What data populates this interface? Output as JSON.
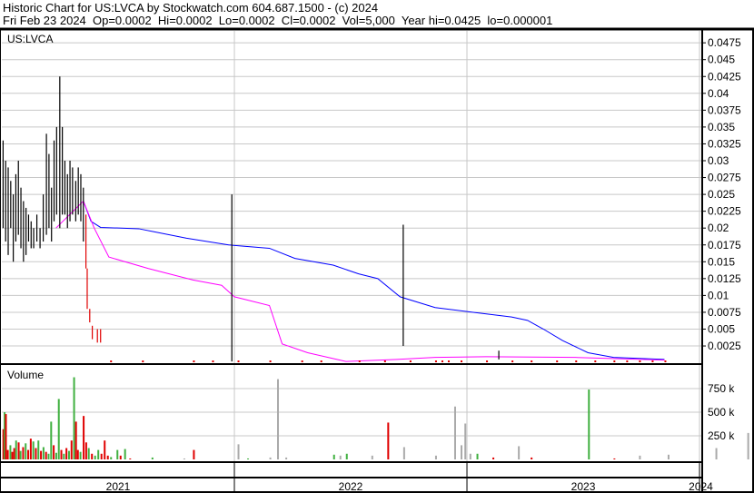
{
  "header": {
    "title": "Historic Chart for US:LVCA by Stockwatch.com 604.687.1500 - (c) 2024",
    "quote": "Fri Feb 23 2024  Op=0.0002  Hi=0.0002  Lo=0.0002  Cl=0.0002  Vol=5,000  Year hi=0.0425  lo=0.000001"
  },
  "chart_data": {
    "type": "line",
    "title": "US:LVCA",
    "volume_label": "Volume",
    "x_unit": "days since 2021-01-01",
    "x_range": [
      0,
      1100
    ],
    "year_ticks": [
      {
        "label": "2021",
        "day": 0
      },
      {
        "label": "2022",
        "day": 365
      },
      {
        "label": "2023",
        "day": 730
      },
      {
        "label": "2024",
        "day": 1095
      }
    ],
    "price_ylim": [
      0,
      0.05
    ],
    "price_ticks": [
      "0.0025",
      "0.005",
      "0.0075",
      "0.01",
      "0.0125",
      "0.015",
      "0.0175",
      "0.02",
      "0.0225",
      "0.025",
      "0.0275",
      "0.03",
      "0.0325",
      "0.035",
      "0.0375",
      "0.04",
      "0.0425",
      "0.045",
      "0.0475"
    ],
    "volume_ylim": [
      0,
      1000000
    ],
    "volume_ticks": [
      {
        "label": "250 k",
        "value": 250000
      },
      {
        "label": "500 k",
        "value": 500000
      },
      {
        "label": "750 k",
        "value": 750000
      }
    ],
    "price_bars": [
      [
        2,
        0.033,
        0.02
      ],
      [
        6,
        0.03,
        0.018
      ],
      [
        10,
        0.029,
        0.016
      ],
      [
        14,
        0.027,
        0.02
      ],
      [
        18,
        0.025,
        0.015
      ],
      [
        22,
        0.028,
        0.018
      ],
      [
        26,
        0.03,
        0.019
      ],
      [
        30,
        0.026,
        0.017
      ],
      [
        34,
        0.024,
        0.015
      ],
      [
        38,
        0.023,
        0.016
      ],
      [
        42,
        0.022,
        0.018
      ],
      [
        46,
        0.021,
        0.017
      ],
      [
        50,
        0.02,
        0.017
      ],
      [
        55,
        0.022,
        0.018
      ],
      [
        60,
        0.02,
        0.017
      ],
      [
        65,
        0.025,
        0.018
      ],
      [
        70,
        0.034,
        0.019
      ],
      [
        74,
        0.031,
        0.02
      ],
      [
        78,
        0.026,
        0.018
      ],
      [
        82,
        0.033,
        0.021
      ],
      [
        86,
        0.035,
        0.022
      ],
      [
        91,
        0.0425,
        0.02
      ],
      [
        95,
        0.035,
        0.022
      ],
      [
        99,
        0.03,
        0.022
      ],
      [
        103,
        0.028,
        0.02
      ],
      [
        107,
        0.03,
        0.021
      ],
      [
        111,
        0.029,
        0.022
      ],
      [
        116,
        0.027,
        0.021
      ],
      [
        120,
        0.029,
        0.022
      ],
      [
        124,
        0.028,
        0.021
      ],
      [
        128,
        0.026,
        0.018
      ],
      [
        132,
        0.022,
        0.014
      ],
      [
        134,
        0.014,
        0.008
      ],
      [
        138,
        0.008,
        0.006
      ],
      [
        142,
        0.0055,
        0.0035
      ],
      [
        150,
        0.005,
        0.003
      ],
      [
        155,
        0.005,
        0.003
      ],
      [
        361,
        0.025,
        0.0002
      ],
      [
        630,
        0.0205,
        0.0025
      ],
      [
        780,
        0.0018,
        0.0005
      ]
    ],
    "low_dots": [
      170,
      220,
      300,
      330,
      370,
      420,
      470,
      500,
      560,
      600,
      640,
      680,
      690,
      700,
      720,
      760,
      800,
      830,
      870,
      900,
      930,
      960,
      980,
      1000,
      1020,
      1040
    ],
    "ma_long": [
      [
        128,
        0.024
      ],
      [
        140,
        0.021
      ],
      [
        155,
        0.0201
      ],
      [
        215,
        0.0199
      ],
      [
        290,
        0.0185
      ],
      [
        356,
        0.0175
      ],
      [
        420,
        0.017
      ],
      [
        460,
        0.0155
      ],
      [
        520,
        0.0145
      ],
      [
        560,
        0.0132
      ],
      [
        590,
        0.0125
      ],
      [
        625,
        0.0098
      ],
      [
        680,
        0.0082
      ],
      [
        740,
        0.0075
      ],
      [
        800,
        0.0068
      ],
      [
        825,
        0.0063
      ],
      [
        850,
        0.005
      ],
      [
        880,
        0.0033
      ],
      [
        920,
        0.0015
      ],
      [
        960,
        0.0008
      ],
      [
        1040,
        0.0005
      ]
    ],
    "ma_short": [
      [
        85,
        0.02
      ],
      [
        128,
        0.024
      ],
      [
        145,
        0.02
      ],
      [
        168,
        0.0157
      ],
      [
        230,
        0.014
      ],
      [
        300,
        0.0123
      ],
      [
        345,
        0.0115
      ],
      [
        365,
        0.0098
      ],
      [
        420,
        0.0085
      ],
      [
        440,
        0.0028
      ],
      [
        480,
        0.0015
      ],
      [
        540,
        0.0002
      ],
      [
        620,
        0.0005
      ],
      [
        680,
        0.0008
      ],
      [
        760,
        0.0009
      ],
      [
        900,
        0.0008
      ],
      [
        1040,
        0.0004
      ]
    ],
    "volume_bars": [
      [
        1,
        320000,
        "#e00000"
      ],
      [
        3,
        500000,
        "#40b040"
      ],
      [
        5,
        480000,
        "#e00000"
      ],
      [
        8,
        100000,
        "#e00000"
      ],
      [
        12,
        150000,
        "#40b040"
      ],
      [
        15,
        80000,
        "#e00000"
      ],
      [
        18,
        120000,
        "#e00000"
      ],
      [
        21,
        200000,
        "#40b040"
      ],
      [
        25,
        180000,
        "#e00000"
      ],
      [
        28,
        90000,
        "#40b040"
      ],
      [
        32,
        130000,
        "#e00000"
      ],
      [
        36,
        170000,
        "#40b040"
      ],
      [
        40,
        100000,
        "#e00000"
      ],
      [
        44,
        220000,
        "#e00000"
      ],
      [
        48,
        190000,
        "#40b040"
      ],
      [
        52,
        120000,
        "#e00000"
      ],
      [
        56,
        200000,
        "#40b040"
      ],
      [
        60,
        90000,
        "#e00000"
      ],
      [
        64,
        130000,
        "#40b040"
      ],
      [
        68,
        80000,
        "#e00000"
      ],
      [
        72,
        60000,
        "#40b040"
      ],
      [
        76,
        400000,
        "#40b040"
      ],
      [
        80,
        150000,
        "#e00000"
      ],
      [
        84,
        70000,
        "#40b040"
      ],
      [
        88,
        640000,
        "#40b040"
      ],
      [
        92,
        100000,
        "#e00000"
      ],
      [
        96,
        60000,
        "#40b040"
      ],
      [
        100,
        120000,
        "#e00000"
      ],
      [
        104,
        90000,
        "#40b040"
      ],
      [
        108,
        200000,
        "#e00000"
      ],
      [
        112,
        870000,
        "#40b040"
      ],
      [
        115,
        400000,
        "#e00000"
      ],
      [
        118,
        100000,
        "#e00000"
      ],
      [
        122,
        80000,
        "#40b040"
      ],
      [
        127,
        460000,
        "#e00000"
      ],
      [
        131,
        180000,
        "#e00000"
      ],
      [
        135,
        120000,
        "#40b040"
      ],
      [
        140,
        60000,
        "#e00000"
      ],
      [
        145,
        40000,
        "#40b040"
      ],
      [
        150,
        100000,
        "#40b040"
      ],
      [
        155,
        60000,
        "#e00000"
      ],
      [
        160,
        200000,
        "#e00000"
      ],
      [
        165,
        40000,
        "#e00000"
      ],
      [
        170,
        25000,
        "#40b040"
      ],
      [
        180,
        100000,
        "#40b040"
      ],
      [
        185,
        40000,
        "#e00000"
      ],
      [
        192,
        110000,
        "#40b040"
      ],
      [
        200,
        10000,
        "#e00000"
      ],
      [
        235,
        20000,
        "#40b040"
      ],
      [
        285,
        10000,
        "#aaaaaa"
      ],
      [
        300,
        100000,
        "#e00000"
      ],
      [
        370,
        160000,
        "#aaaaaa"
      ],
      [
        385,
        10000,
        "#40b040"
      ],
      [
        420,
        20000,
        "#aaaaaa"
      ],
      [
        432,
        850000,
        "#aaaaaa"
      ],
      [
        445,
        20000,
        "#aaaaaa"
      ],
      [
        520,
        50000,
        "#40b040"
      ],
      [
        530,
        40000,
        "#aaaaaa"
      ],
      [
        540,
        60000,
        "#40b040"
      ],
      [
        580,
        40000,
        "#aaaaaa"
      ],
      [
        605,
        390000,
        "#e00000"
      ],
      [
        630,
        130000,
        "#aaaaaa"
      ],
      [
        680,
        40000,
        "#aaaaaa"
      ],
      [
        710,
        560000,
        "#aaaaaa"
      ],
      [
        720,
        150000,
        "#aaaaaa"
      ],
      [
        726,
        380000,
        "#aaaaaa"
      ],
      [
        734,
        60000,
        "#aaaaaa"
      ],
      [
        745,
        60000,
        "#40b040"
      ],
      [
        770,
        20000,
        "#e00000"
      ],
      [
        810,
        140000,
        "#aaaaaa"
      ],
      [
        830,
        20000,
        "#e00000"
      ],
      [
        920,
        740000,
        "#40b040"
      ],
      [
        960,
        10000,
        "#e00000"
      ],
      [
        1000,
        40000,
        "#aaaaaa"
      ],
      [
        1045,
        50000,
        "#aaaaaa"
      ],
      [
        1120,
        120000,
        "#aaaaaa"
      ],
      [
        1170,
        280000,
        "#aaaaaa"
      ],
      [
        1220,
        20000,
        "#aaaaaa"
      ]
    ],
    "colors": {
      "price": "#000000",
      "down": "#e00000",
      "ma_long": "#0000ff",
      "ma_short": "#ff00ff",
      "grid": "#c8c8c8"
    }
  }
}
